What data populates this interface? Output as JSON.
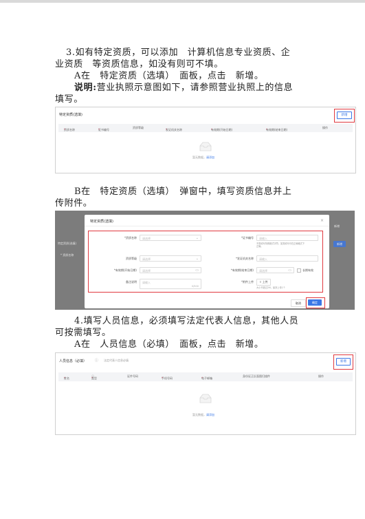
{
  "section3": {
    "line1": "3.如有特定资质，可以添加　计算机信息专业资质、企",
    "line2": "业资质　等资质信息，如没有则可不填。",
    "stepA": "A在　特定资质（选填）　面板，点击　新增。",
    "note_label": "说明:",
    "note_text": "营业执照示意图如下，请参照营业执照上的信息",
    "note_line2": "填写。"
  },
  "figure1": {
    "title": "特定资质(选填)",
    "add_button": "新增",
    "columns": [
      "资质名称",
      "证书编号",
      "资质等级",
      "发证机关名称",
      "有效期(开始日期)",
      "有效期(结束日期)",
      "操作"
    ],
    "required": [
      true,
      true,
      false,
      true,
      true,
      true,
      false
    ],
    "empty_text": "暂无数据，",
    "empty_link": "请添加"
  },
  "sectionB": {
    "line1": "B在　特定资质（选填）　弹窗中，填写资质信息并上",
    "line2": "传附件。"
  },
  "figure2": {
    "dialog_title": "特定资质(选填)",
    "close": "×",
    "bg_left_title": "特定资质(选填)",
    "bg_left_col": "* 资质名称",
    "bg_right_label": "新增",
    "bg_right_top": "新增",
    "fields": {
      "name_label": "*资质名称",
      "name_placeholder": "请选择",
      "cert_label": "*证书编号",
      "cert_placeholder": "请输入",
      "cert_hint_1": "不需填写特殊格式字符，如需填写可在正确格式下",
      "cert_hint_2": "正确。",
      "level_label": "资质等级",
      "level_placeholder": "请选择",
      "issuer_label": "*发证机关名称",
      "issuer_placeholder": "请输入",
      "start_label": "*有效期(开始日期)",
      "start_placeholder": "请选择",
      "end_label": "*有效期(结束日期)",
      "end_placeholder": "请选择",
      "longterm_label": "长期有效",
      "remark_label": "备注说明",
      "remark_placeholder": "请输入",
      "remark_counter": "0/500",
      "attach_label": "*附件上传",
      "upload_button": "上传",
      "upload_hint": "大小不超过2M，最多上传1个"
    },
    "cancel_button": "取消",
    "ok_button": "确定"
  },
  "section4": {
    "line1": "4.填写人员信息，必须填写法定代表人信息，其他人员",
    "line2": "可按需填写。",
    "stepA": "A在　人员信息（必填）　面板，点击　新增。"
  },
  "figure3": {
    "title": "人员信息（必填）",
    "subtitle": "法定代表人信息必填",
    "add_button": "新增",
    "columns": [
      "姓名",
      "类型",
      "证件号码",
      "手机号码",
      "电子邮箱",
      "身份证正反面图扫描件",
      "操作"
    ],
    "required": [
      true,
      true,
      false,
      true,
      true,
      false,
      false
    ],
    "empty_text": "暂无数据，",
    "empty_link": "请添加"
  }
}
